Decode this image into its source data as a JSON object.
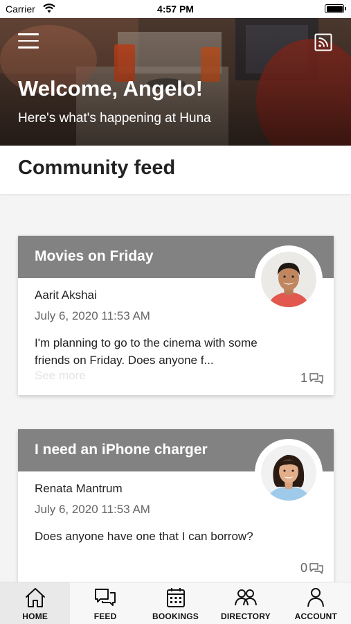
{
  "status_bar": {
    "carrier": "Carrier",
    "time": "4:57 PM"
  },
  "hero": {
    "title": "Welcome, Angelo!",
    "subtitle": "Here's what's happening at Huna",
    "menu_icon": "hamburger-menu-icon",
    "rss_icon": "rss-feed-icon"
  },
  "page": {
    "title": "Community feed"
  },
  "posts": [
    {
      "title": "Movies on Friday",
      "author": "Aarit Akshai",
      "date": "July 6, 2020 11:53 AM",
      "body": "I'm planning to go to the cinema with some friends on Friday. Does anyone f...",
      "see_more": "See more",
      "comment_count": "1",
      "avatar_icon": "man-avatar"
    },
    {
      "title": "I need an iPhone charger",
      "author": "Renata Mantrum",
      "date": "July 6, 2020 11:53 AM",
      "body": "Does anyone have one that I can borrow?",
      "comment_count": "0",
      "avatar_icon": "woman-avatar"
    }
  ],
  "tabs": [
    {
      "label": "HOME",
      "icon": "home-icon",
      "active": true
    },
    {
      "label": "FEED",
      "icon": "chat-bubbles-icon"
    },
    {
      "label": "BOOKINGS",
      "icon": "calendar-icon"
    },
    {
      "label": "DIRECTORY",
      "icon": "people-icon"
    },
    {
      "label": "ACCOUNT",
      "icon": "person-icon"
    }
  ],
  "colors": {
    "post_header": "#828282",
    "background": "#f4f4f4",
    "tab_active": "#e9e9e9"
  }
}
